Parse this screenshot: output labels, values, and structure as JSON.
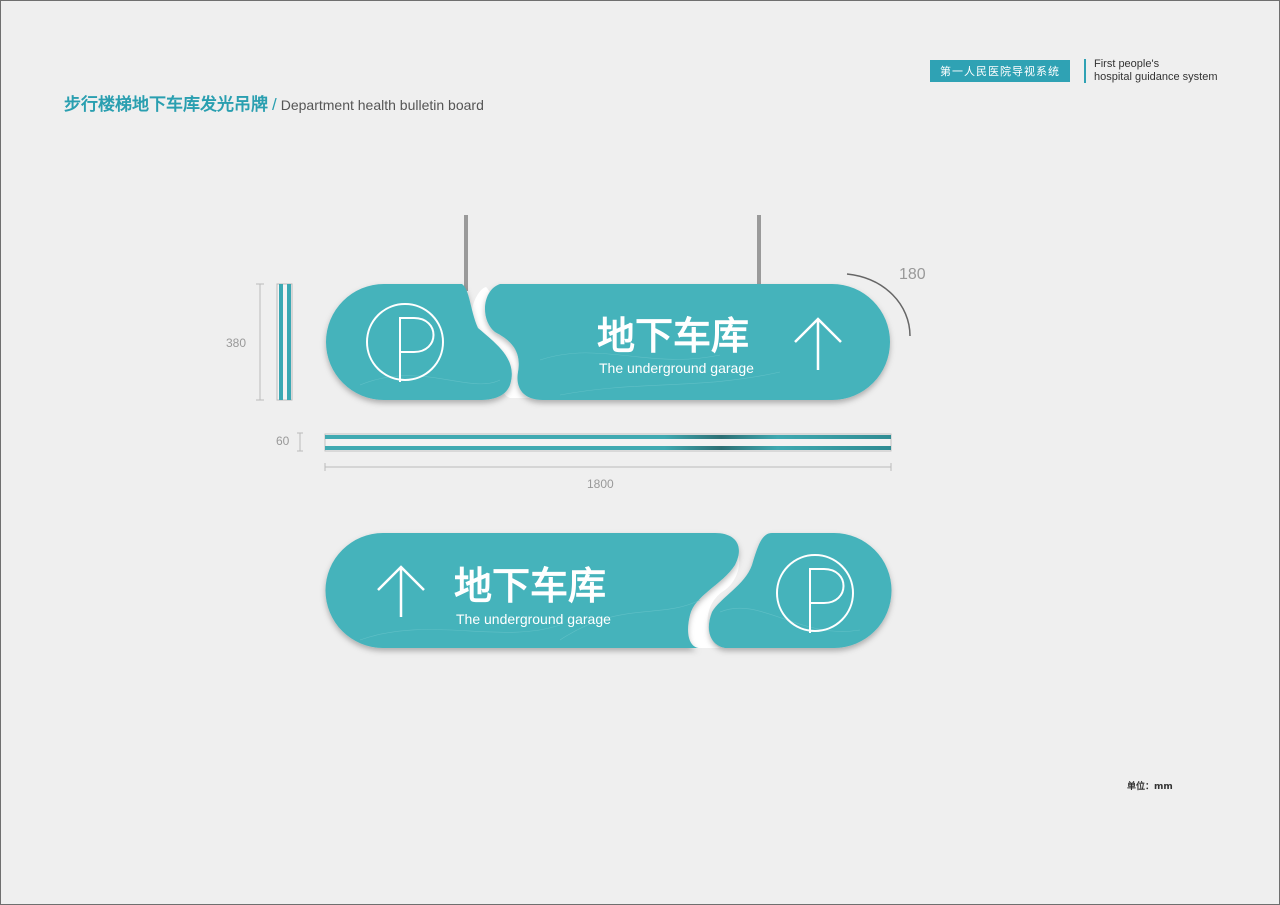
{
  "header": {
    "title_cn": "步行楼梯地下车库发光吊牌",
    "separator": "/",
    "title_en": "Department health bulletin board"
  },
  "brand": {
    "name_cn": "第一人民医院导视系统",
    "name_en_line1": "First people's",
    "name_en_line2": "hospital guidance system"
  },
  "dimensions": {
    "height": "380",
    "thickness": "60",
    "width": "1800",
    "corner_radius": "180"
  },
  "sign_front": {
    "title_cn": "地下车库",
    "title_en": "The underground garage",
    "parking_symbol": "P",
    "arrow_icon": "arrow-up-icon"
  },
  "sign_back": {
    "title_cn": "地下车库",
    "title_en": "The underground garage",
    "parking_symbol": "P",
    "arrow_icon": "arrow-up-icon"
  },
  "unit_note": "单位：mm",
  "colors": {
    "accent": "#2fa2b4",
    "panel": "#45b3bb",
    "background": "#efefef"
  }
}
